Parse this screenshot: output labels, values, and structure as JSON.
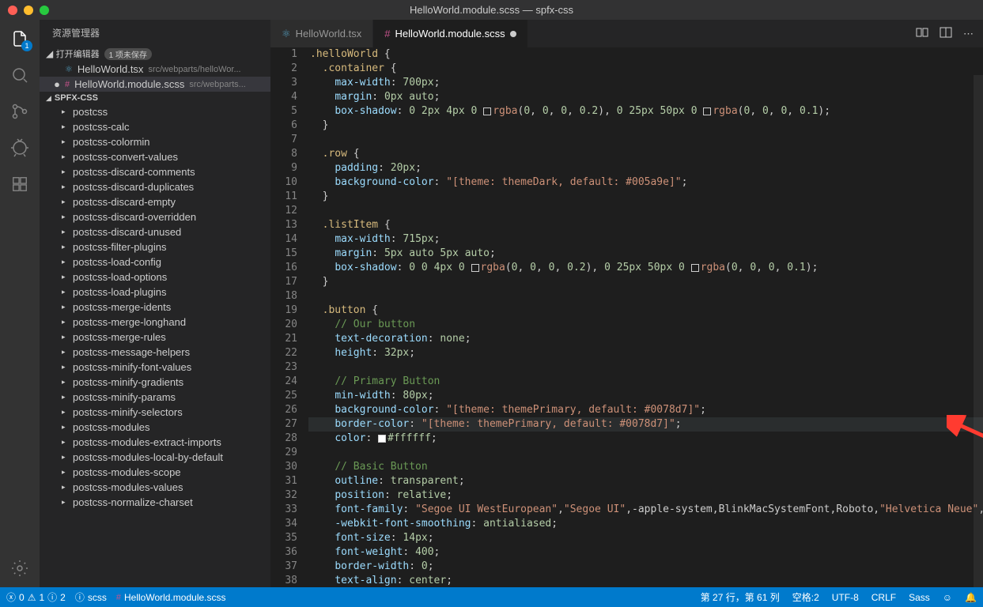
{
  "title": "HelloWorld.module.scss — spfx-css",
  "activity_badge": "1",
  "sidebar": {
    "header": "资源管理器",
    "openeditors_label": "打开编辑器",
    "openeditors_count": "1 项未保存",
    "files": [
      {
        "dot": "",
        "icon": "tsx",
        "name": "HelloWorld.tsx",
        "path": "src/webparts/helloWor..."
      },
      {
        "dot": "●",
        "icon": "scss",
        "name": "HelloWorld.module.scss",
        "path": "src/webparts..."
      }
    ],
    "project": "SPFX-CSS",
    "tree": [
      "postcss",
      "postcss-calc",
      "postcss-colormin",
      "postcss-convert-values",
      "postcss-discard-comments",
      "postcss-discard-duplicates",
      "postcss-discard-empty",
      "postcss-discard-overridden",
      "postcss-discard-unused",
      "postcss-filter-plugins",
      "postcss-load-config",
      "postcss-load-options",
      "postcss-load-plugins",
      "postcss-merge-idents",
      "postcss-merge-longhand",
      "postcss-merge-rules",
      "postcss-message-helpers",
      "postcss-minify-font-values",
      "postcss-minify-gradients",
      "postcss-minify-params",
      "postcss-minify-selectors",
      "postcss-modules",
      "postcss-modules-extract-imports",
      "postcss-modules-local-by-default",
      "postcss-modules-scope",
      "postcss-modules-values",
      "postcss-normalize-charset"
    ]
  },
  "tabs": [
    {
      "icon": "tsx",
      "label": "HelloWorld.tsx",
      "active": false,
      "modified": false
    },
    {
      "icon": "scss",
      "label": "HelloWorld.module.scss",
      "active": true,
      "modified": true
    }
  ],
  "gutter_start": 1,
  "gutter_end": 38,
  "code_lines": [
    {
      "html": "<span class='c-sel'>.helloWorld</span> <span class='c-punct'>{</span>"
    },
    {
      "html": "  <span class='c-sel'>.container</span> <span class='c-punct'>{</span>"
    },
    {
      "html": "    <span class='c-prop'>max-width</span><span class='c-punct'>:</span> <span class='c-num'>700px</span><span class='c-punct'>;</span>"
    },
    {
      "html": "    <span class='c-prop'>margin</span><span class='c-punct'>:</span> <span class='c-num'>0px</span> <span class='c-num'>auto</span><span class='c-punct'>;</span>"
    },
    {
      "html": "    <span class='c-prop'>box-shadow</span><span class='c-punct'>:</span> <span class='c-num'>0</span> <span class='c-num'>2px</span> <span class='c-num'>4px</span> <span class='c-num'>0</span> <span class='cbox'></span><span class='c-kw'>rgba</span><span class='c-punct'>(</span><span class='c-num'>0</span><span class='c-punct'>,</span> <span class='c-num'>0</span><span class='c-punct'>,</span> <span class='c-num'>0</span><span class='c-punct'>,</span> <span class='c-num'>0.2</span><span class='c-punct'>),</span> <span class='c-num'>0</span> <span class='c-num'>25px</span> <span class='c-num'>50px</span> <span class='c-num'>0</span> <span class='cbox'></span><span class='c-kw'>rgba</span><span class='c-punct'>(</span><span class='c-num'>0</span><span class='c-punct'>,</span> <span class='c-num'>0</span><span class='c-punct'>,</span> <span class='c-num'>0</span><span class='c-punct'>,</span> <span class='c-num'>0.1</span><span class='c-punct'>);</span>"
    },
    {
      "html": "  <span class='c-punct'>}</span>"
    },
    {
      "html": ""
    },
    {
      "html": "  <span class='c-sel'>.row</span> <span class='c-punct'>{</span>"
    },
    {
      "html": "    <span class='c-prop'>padding</span><span class='c-punct'>:</span> <span class='c-num'>20px</span><span class='c-punct'>;</span>"
    },
    {
      "html": "    <span class='c-prop'>background-color</span><span class='c-punct'>:</span> <span class='c-str'>\"[theme: themeDark, default: #005a9e]\"</span><span class='c-punct'>;</span>"
    },
    {
      "html": "  <span class='c-punct'>}</span>"
    },
    {
      "html": ""
    },
    {
      "html": "  <span class='c-sel'>.listItem</span> <span class='c-punct'>{</span>"
    },
    {
      "html": "    <span class='c-prop'>max-width</span><span class='c-punct'>:</span> <span class='c-num'>715px</span><span class='c-punct'>;</span>"
    },
    {
      "html": "    <span class='c-prop'>margin</span><span class='c-punct'>:</span> <span class='c-num'>5px</span> <span class='c-num'>auto</span> <span class='c-num'>5px</span> <span class='c-num'>auto</span><span class='c-punct'>;</span>"
    },
    {
      "html": "    <span class='c-prop'>box-shadow</span><span class='c-punct'>:</span> <span class='c-num'>0</span> <span class='c-num'>0</span> <span class='c-num'>4px</span> <span class='c-num'>0</span> <span class='cbox'></span><span class='c-kw'>rgba</span><span class='c-punct'>(</span><span class='c-num'>0</span><span class='c-punct'>,</span> <span class='c-num'>0</span><span class='c-punct'>,</span> <span class='c-num'>0</span><span class='c-punct'>,</span> <span class='c-num'>0.2</span><span class='c-punct'>),</span> <span class='c-num'>0</span> <span class='c-num'>25px</span> <span class='c-num'>50px</span> <span class='c-num'>0</span> <span class='cbox'></span><span class='c-kw'>rgba</span><span class='c-punct'>(</span><span class='c-num'>0</span><span class='c-punct'>,</span> <span class='c-num'>0</span><span class='c-punct'>,</span> <span class='c-num'>0</span><span class='c-punct'>,</span> <span class='c-num'>0.1</span><span class='c-punct'>);</span>"
    },
    {
      "html": "  <span class='c-punct'>}</span>"
    },
    {
      "html": ""
    },
    {
      "html": "  <span class='c-sel'>.button</span> <span class='c-punct'>{</span>"
    },
    {
      "html": "    <span class='c-comm'>// Our button</span>"
    },
    {
      "html": "    <span class='c-prop'>text-decoration</span><span class='c-punct'>:</span> <span class='c-num'>none</span><span class='c-punct'>;</span>"
    },
    {
      "html": "    <span class='c-prop'>height</span><span class='c-punct'>:</span> <span class='c-num'>32px</span><span class='c-punct'>;</span>"
    },
    {
      "html": ""
    },
    {
      "html": "    <span class='c-comm'>// Primary Button</span>"
    },
    {
      "html": "    <span class='c-prop'>min-width</span><span class='c-punct'>:</span> <span class='c-num'>80px</span><span class='c-punct'>;</span>"
    },
    {
      "html": "    <span class='c-prop'>background-color</span><span class='c-punct'>:</span> <span class='c-str'>\"[theme: themePrimary, default: #0078d7]\"</span><span class='c-punct'>;</span>"
    },
    {
      "hl": true,
      "html": "    <span class='c-prop'>border-color</span><span class='c-punct'>:</span> <span class='c-str'>\"[theme: themePrimary, default: #0078d7]\"</span><span class='c-punct'>;</span>"
    },
    {
      "html": "    <span class='c-prop'>color</span><span class='c-punct'>:</span> <span class='cbox' style='background:#fff'></span><span class='c-num'>#ffffff</span><span class='c-punct'>;</span>"
    },
    {
      "html": ""
    },
    {
      "html": "    <span class='c-comm'>// Basic Button</span>"
    },
    {
      "html": "    <span class='c-prop'>outline</span><span class='c-punct'>:</span> <span class='c-num'>transparent</span><span class='c-punct'>;</span>"
    },
    {
      "html": "    <span class='c-prop'>position</span><span class='c-punct'>:</span> <span class='c-num'>relative</span><span class='c-punct'>;</span>"
    },
    {
      "html": "    <span class='c-prop'>font-family</span><span class='c-punct'>:</span> <span class='c-str'>\"Segoe UI WestEuropean\"</span><span class='c-punct'>,</span><span class='c-str'>\"Segoe UI\"</span><span class='c-punct'>,</span>-apple-system<span class='c-punct'>,</span>BlinkMacSystemFont<span class='c-punct'>,</span>Roboto<span class='c-punct'>,</span><span class='c-str'>\"Helvetica Neue\"</span><span class='c-punct'>,</span>sans-se"
    },
    {
      "html": "    <span class='c-prop'>-webkit-font-smoothing</span><span class='c-punct'>:</span> <span class='c-num'>antialiased</span><span class='c-punct'>;</span>"
    },
    {
      "html": "    <span class='c-prop'>font-size</span><span class='c-punct'>:</span> <span class='c-num'>14px</span><span class='c-punct'>;</span>"
    },
    {
      "html": "    <span class='c-prop'>font-weight</span><span class='c-punct'>:</span> <span class='c-num'>400</span><span class='c-punct'>;</span>"
    },
    {
      "html": "    <span class='c-prop'>border-width</span><span class='c-punct'>:</span> <span class='c-num'>0</span><span class='c-punct'>;</span>"
    },
    {
      "html": "    <span class='c-prop'>text-align</span><span class='c-punct'>:</span> <span class='c-num'>center</span><span class='c-punct'>;</span>"
    }
  ],
  "status": {
    "errors": "0",
    "warnings": "1",
    "info": "2",
    "scss_label": "scss",
    "file": "HelloWorld.module.scss",
    "pos": "第 27 行，第 61 列",
    "spaces": "空格:2",
    "enc": "UTF-8",
    "eol": "CRLF",
    "lang": "Sass"
  }
}
